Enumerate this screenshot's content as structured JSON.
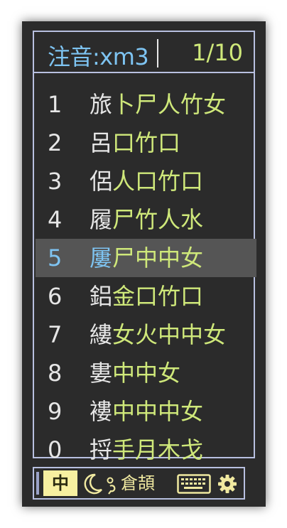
{
  "preedit": {
    "text": "注音:xm3",
    "page_indicator": "1/10"
  },
  "candidates": [
    {
      "num": "1",
      "word": "旅",
      "code": "卜尸人竹女",
      "highlighted": false
    },
    {
      "num": "2",
      "word": "呂",
      "code": "口竹口",
      "highlighted": false
    },
    {
      "num": "3",
      "word": "侶",
      "code": "人口竹口",
      "highlighted": false
    },
    {
      "num": "4",
      "word": "履",
      "code": "尸竹人水",
      "highlighted": false
    },
    {
      "num": "5",
      "word": "屢",
      "code": "尸中中女",
      "highlighted": true
    },
    {
      "num": "6",
      "word": "鋁",
      "code": "金口竹口",
      "highlighted": false
    },
    {
      "num": "7",
      "word": "縷",
      "code": "女火中中女",
      "highlighted": false
    },
    {
      "num": "8",
      "word": "婁",
      "code": "中中女",
      "highlighted": false
    },
    {
      "num": "9",
      "word": "褸",
      "code": "中中中女",
      "highlighted": false
    },
    {
      "num": "0",
      "word": "捋",
      "code": "手月木戈",
      "highlighted": false
    }
  ],
  "status_bar": {
    "mode_label": "中",
    "input_method_label": "倉頡",
    "icons": {
      "moon": "moon-icon",
      "punctuation": "punctuation-icon",
      "keyboard": "keyboard-icon",
      "settings": "gear-icon"
    }
  },
  "colors": {
    "background": "#2b2b2b",
    "border": "#b8c0e0",
    "preedit_text": "#7ec4f2",
    "code_text": "#cfe87a",
    "normal_text": "#e6e6e6",
    "highlight_bg": "#555555",
    "mode_button_bg": "#f7f0a0",
    "status_icon": "#f0e9a0"
  }
}
